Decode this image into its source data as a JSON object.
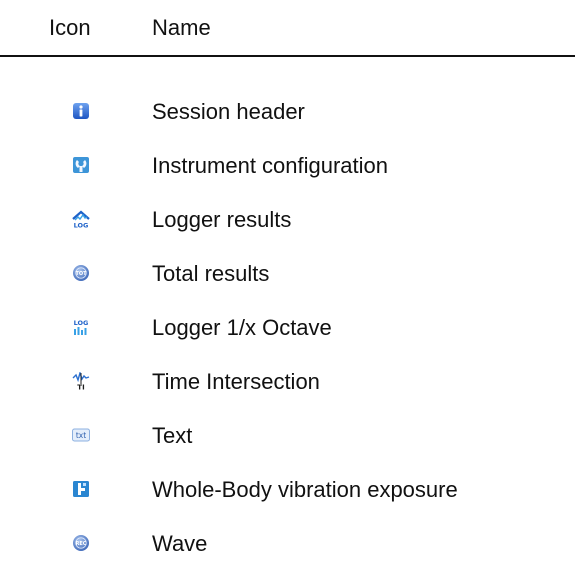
{
  "headers": {
    "icon": "Icon",
    "name": "Name"
  },
  "rows": [
    {
      "icon": "session-header-icon",
      "name": "Session header"
    },
    {
      "icon": "instrument-configuration-icon",
      "name": "Instrument configuration"
    },
    {
      "icon": "logger-results-icon",
      "name": "Logger results"
    },
    {
      "icon": "total-results-icon",
      "name": "Total results"
    },
    {
      "icon": "logger-octave-icon",
      "name": "Logger 1/x Octave"
    },
    {
      "icon": "time-intersection-icon",
      "name": "Time Intersection"
    },
    {
      "icon": "text-icon",
      "name": "Text"
    },
    {
      "icon": "whole-body-vibration-icon",
      "name": "Whole-Body vibration exposure"
    },
    {
      "icon": "wave-icon",
      "name": "Wave"
    }
  ]
}
